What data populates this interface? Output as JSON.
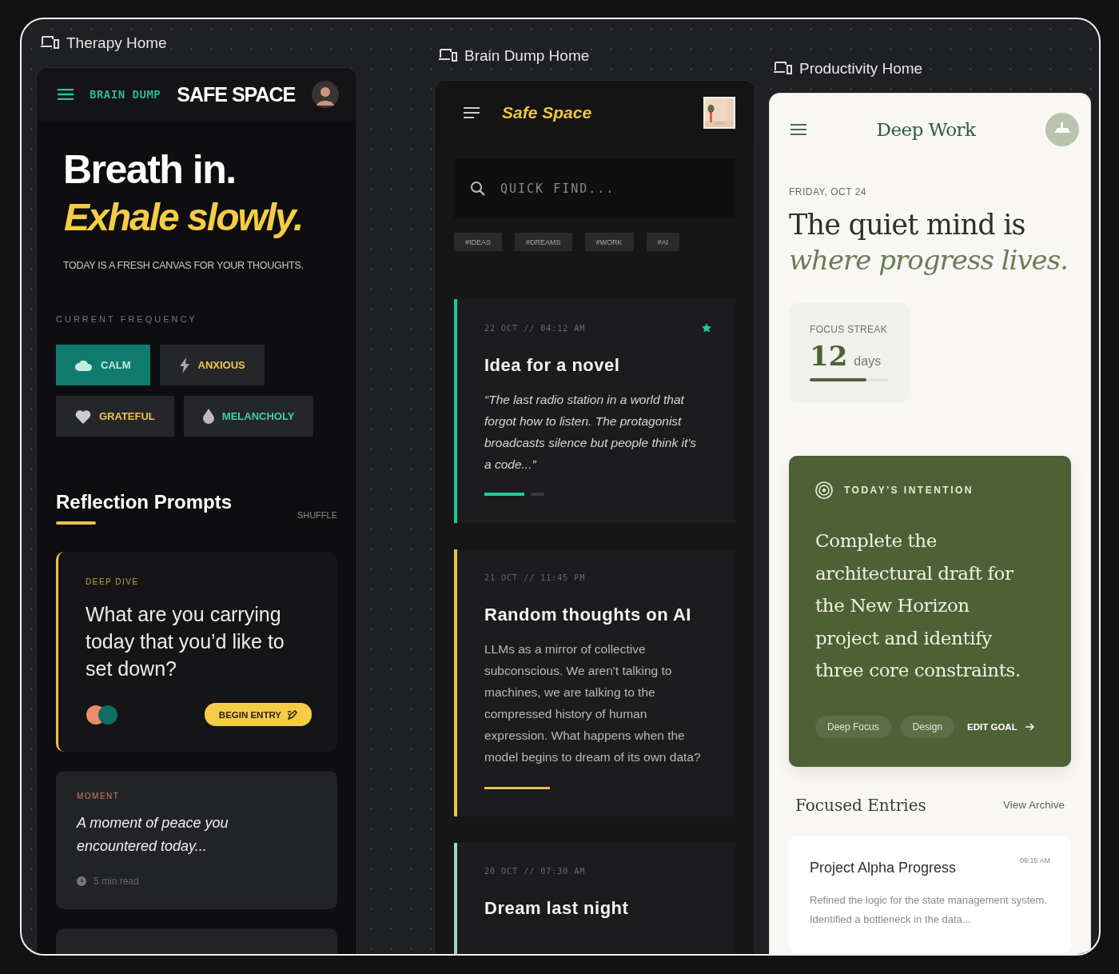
{
  "therapy": {
    "label": "Therapy Home",
    "brand": "BRAIN DUMP",
    "title": "SAFE SPACE",
    "hero": {
      "line1": "Breath in.",
      "line2": "Exhale slowly.",
      "subtitle": "TODAY IS A FRESH CANVAS FOR YOUR THOUGHTS."
    },
    "frequency_label": "CURRENT FREQUENCY",
    "moods": [
      {
        "label": "CALM",
        "selected": true,
        "color": "#bfeee0"
      },
      {
        "label": "ANXIOUS",
        "selected": false,
        "color": "#f0c94e"
      },
      {
        "label": "GRATEFUL",
        "selected": false,
        "color": "#e9c45a"
      },
      {
        "label": "MELANCHOLY",
        "selected": false,
        "color": "#3fcfae"
      }
    ],
    "section": {
      "title": "Reflection Prompts",
      "action": "SHUFFLE"
    },
    "prompts": [
      {
        "kind": "feature",
        "tag": "DEEP DIVE",
        "text": "What are you carrying today that you’d like to set down?",
        "button": "BEGIN ENTRY"
      },
      {
        "kind": "moment",
        "tag": "MOMENT",
        "text": "A moment of peace you encountered today...",
        "meta": "5 min read"
      },
      {
        "kind": "empty"
      }
    ]
  },
  "brain_dump": {
    "label": "Brain Dump Home",
    "title": "Safe Space",
    "search": {
      "placeholder": "QUICK FIND..."
    },
    "tags": [
      "#IDEAS",
      "#DREAMS",
      "#WORK",
      "#AI"
    ],
    "entries": [
      {
        "kind": "quote",
        "date": "22 OCT // 04:12 AM",
        "title": "Idea for a novel",
        "body": "“The last radio station in a world that forgot how to listen. The protagonist broadcasts silence but people think it’s a code...”",
        "starred": true,
        "color": "#22c79a"
      },
      {
        "kind": "note",
        "date": "21 OCT // 11:45 PM",
        "title": "Random thoughts on AI",
        "body": "LLMs as a mirror of collective subconscious. We aren't talking to machines, we are talking to the compressed history of human expression. What happens when the model begins to dream of its own data?",
        "starred": false,
        "color": "#e3c24a"
      },
      {
        "date": "20 OCT // 07:30 AM",
        "title": "Dream last night",
        "starred": false,
        "color": "#9fd6c6"
      }
    ]
  },
  "productivity": {
    "label": "Productivity Home",
    "title": "Deep Work",
    "date": "FRIDAY, OCT 24",
    "headline1": "The quiet mind is",
    "headline2": "where progress lives.",
    "streak": {
      "label": "FOCUS STREAK",
      "value": "12",
      "unit": "days",
      "level": 0.72
    },
    "intention": {
      "label": "TODAY'S INTENTION",
      "text": "Complete the architectural draft for the New Horizon project and identify three core constraints.",
      "tags": [
        "Deep Focus",
        "Design"
      ],
      "action": "EDIT GOAL"
    },
    "section": {
      "title": "Focused Entries",
      "action": "View Archive"
    },
    "entries": [
      {
        "title": "Project Alpha Progress",
        "time": "09:15 AM",
        "body": "Refined the logic for the state management system. Identified a bottleneck in the data..."
      }
    ]
  }
}
